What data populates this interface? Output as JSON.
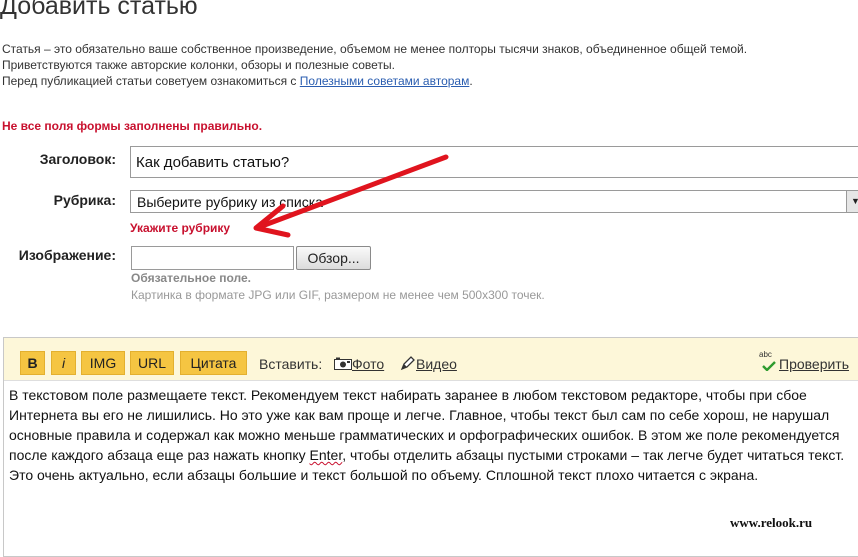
{
  "page": {
    "title": "Добавить статью",
    "intro_line1": "Статья – это обязательно ваше собственное произведение, объемом не менее полторы тысячи знаков, объединенное общей темой.",
    "intro_line2": "Приветствуются также авторские колонки, обзоры и полезные советы.",
    "intro_line3_prefix": "Перед публикацией статьи советуем ознакомиться с ",
    "intro_link": "Полезными советами авторам",
    "intro_line3_suffix": "."
  },
  "form": {
    "error_message": "Не все поля формы заполнены правильно.",
    "title_label": "Заголовок:",
    "title_value": "Как добавить статью?",
    "rubric_label": "Рубрика:",
    "rubric_selected": "Выберите рубрику из списка",
    "rubric_error": "Укажите рубрику",
    "image_label": "Изображение:",
    "image_path": "",
    "browse_label": "Обзор...",
    "required_note": "Обязательное поле.",
    "image_hint": "Картинка в формате JPG или GIF, размером не менее чем 500x300 точек."
  },
  "editor": {
    "toolbar": {
      "bold": "B",
      "italic": "i",
      "img": "IMG",
      "url": "URL",
      "quote": "Цитата",
      "insert_label": "Вставить:",
      "photo": "Фото",
      "video": "Видео",
      "check_badge": "abc",
      "check": "Проверить"
    },
    "text_before": "В текстовом поле размещаете текст. Рекомендуем текст набирать заранее в любом текстовом редакторе, чтобы при сбое Интернета вы его не лишились. Но это уже как вам проще и легче. Главное, чтобы текст был сам по себе хорош, не нарушал основные правила и содержал как можно меньше грамматических и орфографических ошибок. В этом же поле рекомендуется после каждого абзаца еще раз нажать кнопку ",
    "text_key": "Enter",
    "text_after": ", чтобы отделить абзацы пустыми строками – так легче будет читаться текст. Это очень актуально, если абзацы большие и текст большой по объему. Сплошной текст плохо читается с экрана."
  },
  "watermark": "www.relook.ru",
  "colors": {
    "error_red": "#c8102e",
    "link_blue": "#2a5db0",
    "toolbar_bg": "#fdf7d9",
    "button_yellow": "#f5c542",
    "annotation_arrow": "#e0141e"
  },
  "icons": {
    "photo": "camera-icon",
    "video": "pen-icon",
    "check": "spellcheck-icon",
    "dropdown": "chevron-down-icon"
  }
}
